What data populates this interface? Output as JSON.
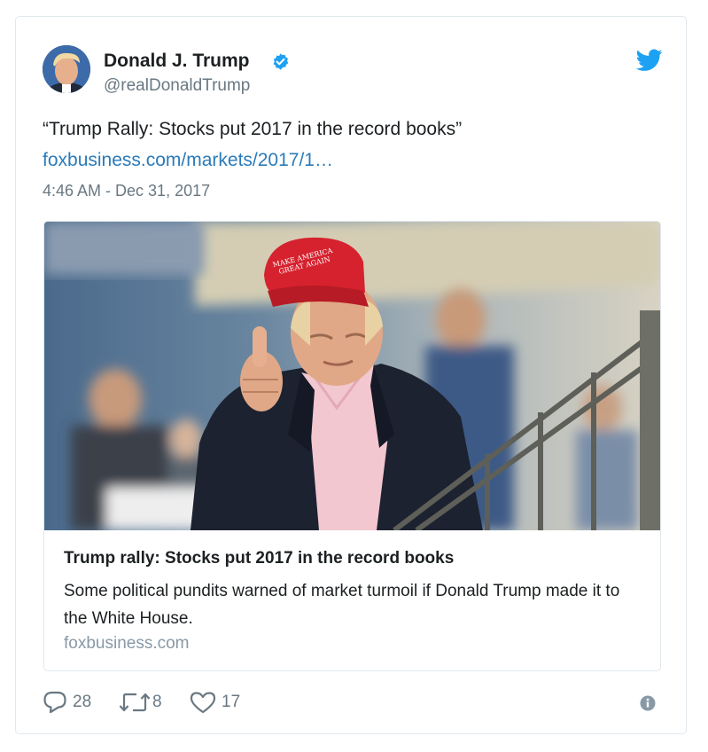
{
  "author": {
    "name": "Donald J. Trump",
    "handle": "@realDonaldTrump",
    "verified": true,
    "avatar_icon": "profile-photo"
  },
  "tweet": {
    "text": "“Trump Rally: Stocks put 2017 in the record books”",
    "link": "foxbusiness.com/markets/2017/1…",
    "timestamp": "4:46 AM - Dec 31, 2017"
  },
  "card": {
    "image_icon": "photo-man-thumbs-up-red-cap",
    "cap_text_line1": "MAKE AMERICA",
    "cap_text_line2": "GREAT AGAIN",
    "title": "Trump rally: Stocks put 2017 in the record books",
    "description": "Some political pundits warned of market turmoil if Donald Trump made it to the White House.",
    "domain": "foxbusiness.com"
  },
  "actions": {
    "replies": "28",
    "retweets": "8",
    "likes": "17"
  },
  "colors": {
    "link": "#2b7bb9",
    "twitter_blue": "#1da1f2",
    "muted": "#697882",
    "border": "#e1e8ed"
  }
}
